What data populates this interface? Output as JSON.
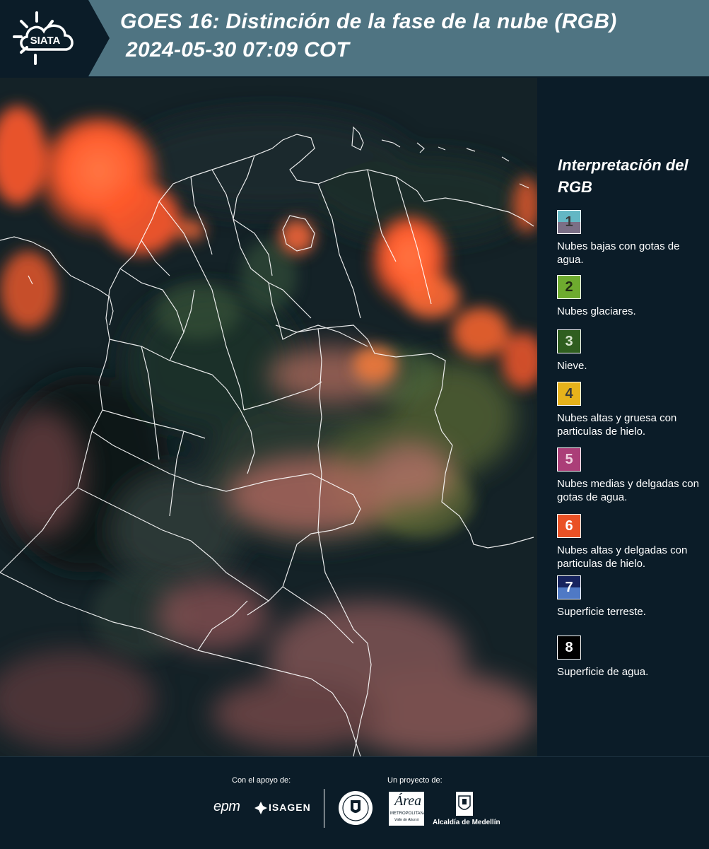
{
  "header": {
    "brand": "SIATA",
    "title": "GOES 16: Distinción de la fase de la nube (RGB)",
    "datetime": "2024-05-30 07:09 COT"
  },
  "legend": {
    "title": "Interpretación del RGB",
    "items": [
      {
        "number": "1",
        "label": "Nubes bajas con gotas de agua.",
        "top_color": "#63b7c4",
        "bottom_color": "#7b6f86",
        "number_color": "#3a3a3a"
      },
      {
        "number": "2",
        "label": "Nubes glaciares.",
        "top_color": "#6eab2f",
        "bottom_color": "#6eab2f",
        "number_color": "#1f2a12"
      },
      {
        "number": "3",
        "label": "Nieve.",
        "top_color": "#2f5e1f",
        "bottom_color": "#2f5e1f",
        "number_color": "#d9e6d0"
      },
      {
        "number": "4",
        "label": "Nubes altas y gruesa con particulas de hielo.",
        "top_color": "#e7b21b",
        "bottom_color": "#e7b21b",
        "number_color": "#3a3a3a"
      },
      {
        "number": "5",
        "label": "Nubes medias y delgadas con gotas de agua.",
        "top_color": "#ab3e78",
        "bottom_color": "#ab3e78",
        "number_color": "#f0d0e0"
      },
      {
        "number": "6",
        "label": "Nubes altas y delgadas con particulas de hielo.",
        "top_color": "#ea5125",
        "bottom_color": "#ea5125",
        "number_color": "#ffffff"
      },
      {
        "number": "7",
        "label": "Superficie terreste.",
        "top_color": "#16235e",
        "bottom_color": "#4f79c5",
        "number_color": "#ffffff"
      },
      {
        "number": "8",
        "label": "Superficie de agua.",
        "top_color": "#000000",
        "bottom_color": "#000000",
        "number_color": "#ffffff"
      }
    ]
  },
  "footer": {
    "support_label": "Con el apoyo de:",
    "project_label": "Un proyecto de:",
    "logo_epm": "epm",
    "logo_isagen": "ISAGEN",
    "logo_area_top": "Área",
    "logo_area_mid": "METROPOLITANA",
    "logo_area_bottom": "Valle de Aburrá",
    "logo_alcaldia": "Alcaldía de Medellín"
  },
  "colors": {
    "header_bg": "#4f7482",
    "logo_tab_bg": "#0b1c28",
    "page_bg": "#0b1c28",
    "cloud_ice": "#ff5a2c",
    "boundary": "#ffffff"
  }
}
